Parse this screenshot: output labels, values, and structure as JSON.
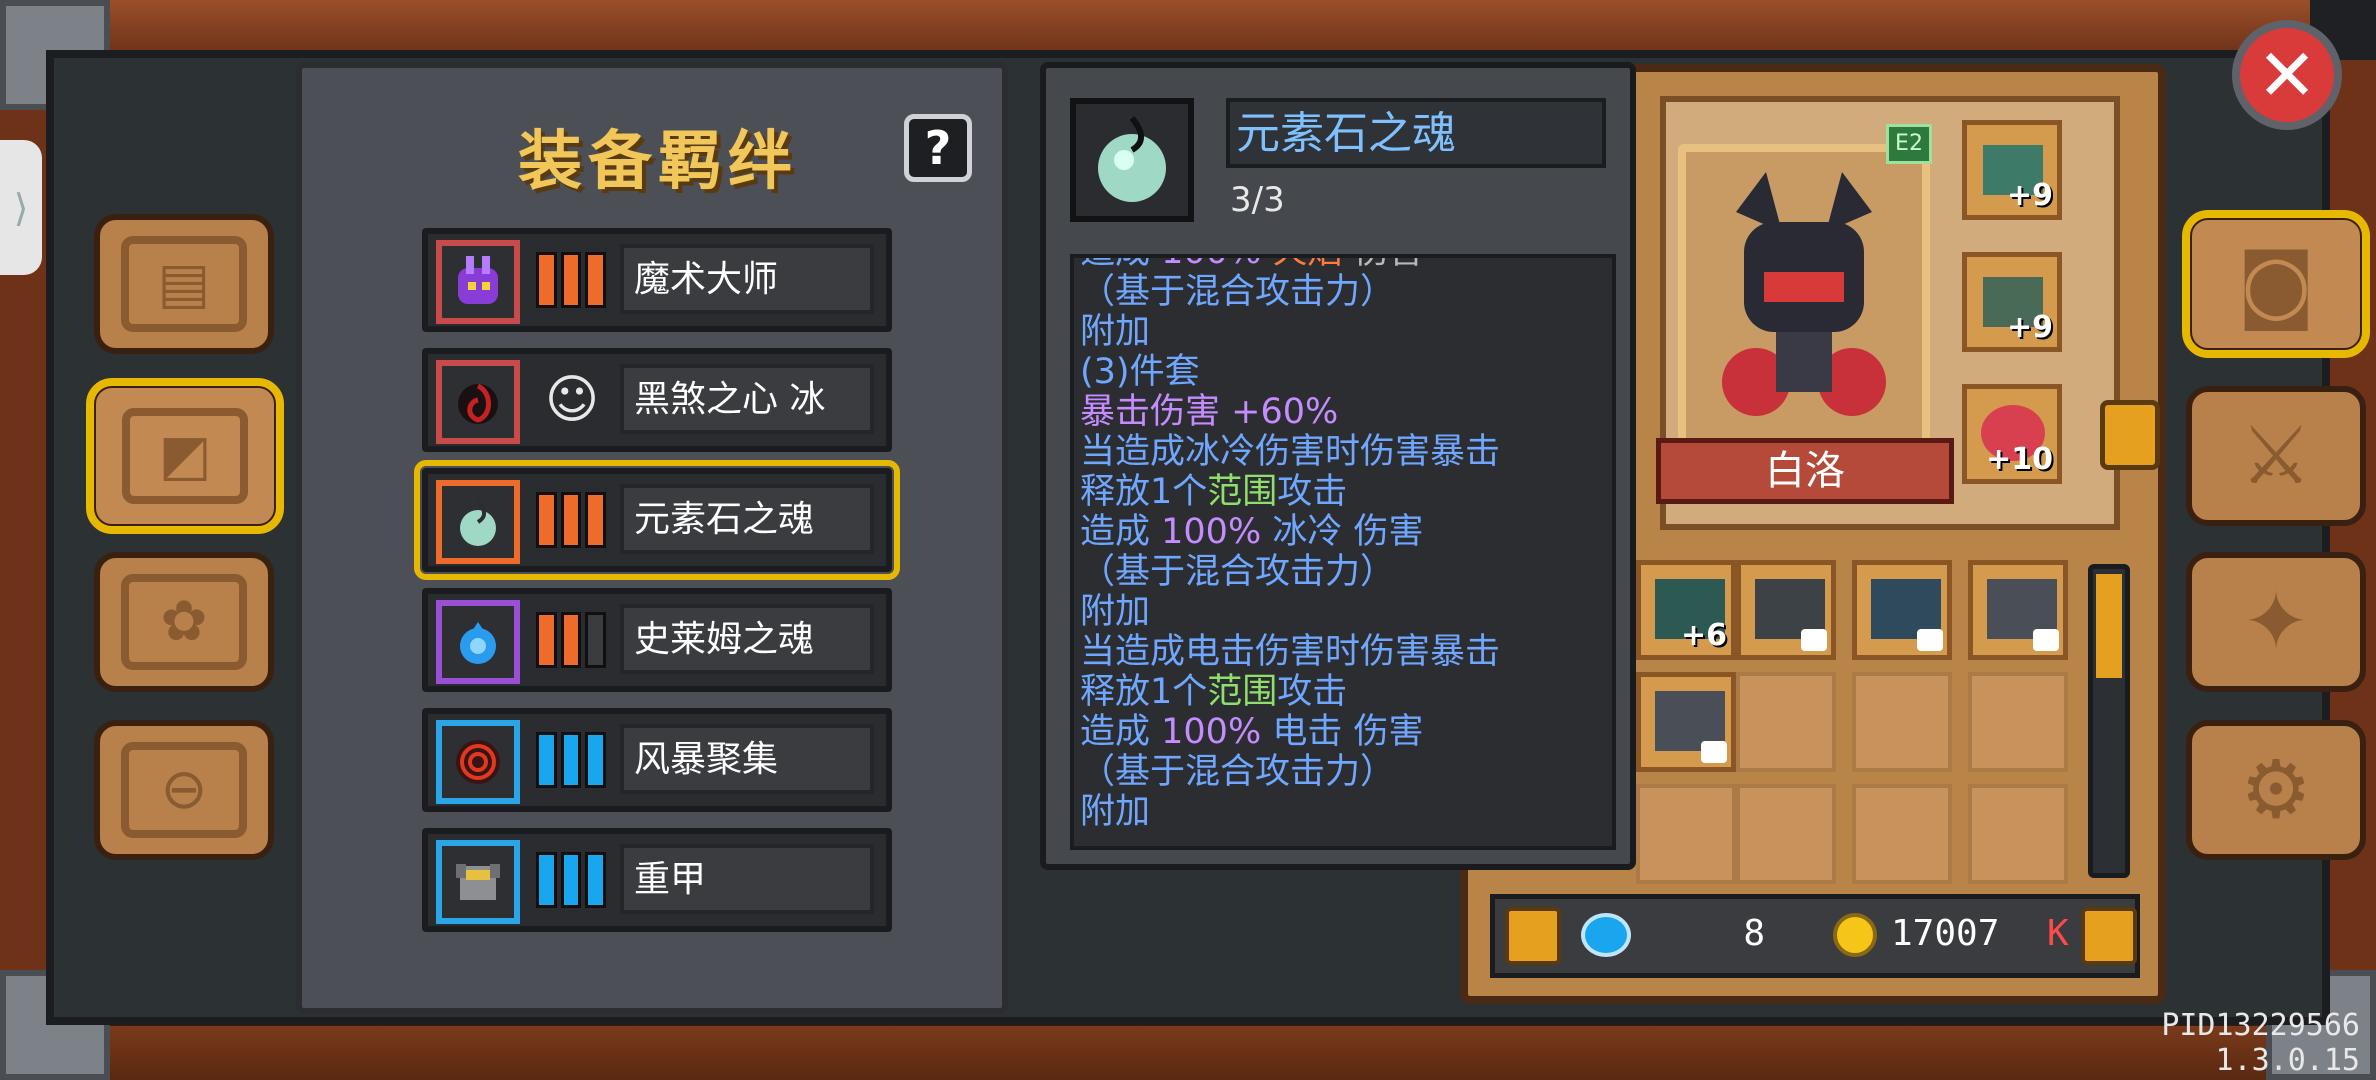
{
  "bond_panel": {
    "title": "装备羁绊",
    "help_label": "?",
    "bonds": [
      {
        "name": "魔术大师",
        "icon": "purple-bunny-icon",
        "tier_color": "#ef6b2b",
        "bars_filled": 3,
        "bars_total": 3
      },
      {
        "name": "黑煞之心 冰",
        "icon": "black-heart-icon",
        "tier_color": "#c94a4a",
        "tier_glyph": "☺",
        "bars_filled": 0,
        "bars_total": 0
      },
      {
        "name": "元素石之魂",
        "icon": "element-soul-icon",
        "tier_color": "#ef6b2b",
        "bars_filled": 3,
        "bars_total": 3
      },
      {
        "name": "史莱姆之魂",
        "icon": "slime-soul-icon",
        "tier_color": "#ef6b2b",
        "bars_filled": 2,
        "bars_total": 3
      },
      {
        "name": "风暴聚集",
        "icon": "storm-target-icon",
        "tier_color": "#1aa6ee",
        "bars_filled": 3,
        "bars_total": 3
      },
      {
        "name": "重甲",
        "icon": "heavy-armor-icon",
        "tier_color": "#1aa6ee",
        "bars_filled": 3,
        "bars_total": 3
      }
    ]
  },
  "tooltip": {
    "title": "元素石之魂",
    "count": "3/3"
  },
  "character": {
    "name": "白洛",
    "badge": "E2",
    "equip_plus": [
      "+9",
      "+9",
      "+10"
    ],
    "inventory_plus": "+6"
  },
  "currency": {
    "gems": "8",
    "gold": "17007",
    "gold_suffix": "K"
  },
  "left_nav": [
    "book-icon",
    "scroll-map-icon",
    "pets-icon",
    "bell-icon"
  ],
  "right_nav": [
    "helmet-icon",
    "swords-icon",
    "compass-icon",
    "gear-icon"
  ],
  "version": "PID13229566 1.3.0.15",
  "colors": {
    "accent_gold": "#e6b800",
    "close_red": "#d93a3a"
  }
}
